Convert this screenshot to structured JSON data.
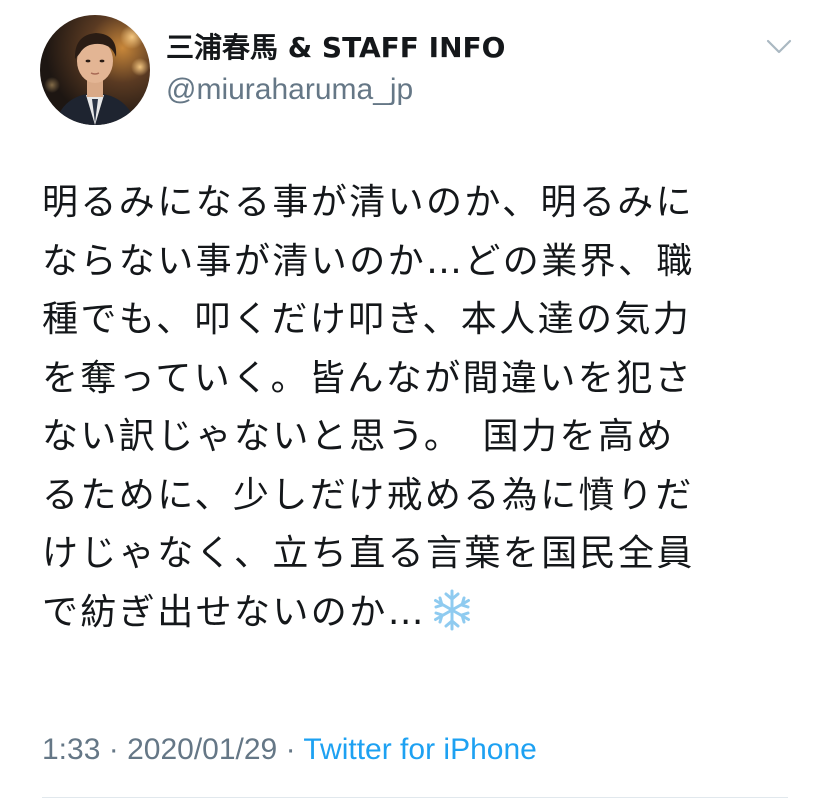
{
  "user": {
    "display_name": "三浦春馬 & STAFF INFO",
    "handle": "@miuraharuma_jp"
  },
  "tweet": {
    "lines": [
      "明るみになる事が清いのか、明るみに",
      "ならない事が清いのか…どの業界、職",
      "種でも、叩くだけ叩き、本人達の気力",
      "を奪っていく。皆んなが間違いを犯さ",
      "ない訳じゃないと思う。　国力を高め",
      "るために、少しだけ戒める為に憤りだ",
      "けじゃなく、立ち直る言葉を国民全員",
      "で紡ぎ出せないのか…"
    ],
    "emoji": "snowflake-icon"
  },
  "meta": {
    "time": "1:33",
    "separator": "·",
    "date": "2020/01/29",
    "source": "Twitter for iPhone"
  },
  "colors": {
    "text": "#14171a",
    "secondary": "#657786",
    "link": "#1da1f2",
    "divider": "#e1e8ed",
    "chevron": "#aab8c2",
    "snowflake": "#8fcbf0"
  }
}
